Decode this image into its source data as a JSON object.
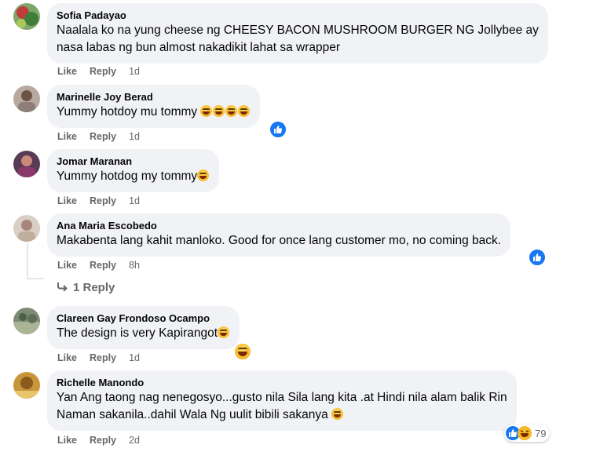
{
  "comments": [
    {
      "author": "Sofia Padayao",
      "text_lines": [
        "Naalala ko na yung cheese ng CHEESY BACON MUSHROOM BURGER NG Jollybee ay",
        "nasa labas ng bun almost nakadikit lahat sa wrapper"
      ],
      "like_label": "Like",
      "reply_label": "Reply",
      "time": "1d"
    },
    {
      "author": "Marinelle Joy Berad",
      "text": "Yummy hotdoy mu tommy",
      "like_label": "Like",
      "reply_label": "Reply",
      "time": "1d"
    },
    {
      "author": "Jomar Maranan",
      "text": "Yummy hotdog my tommy",
      "like_label": "Like",
      "reply_label": "Reply",
      "time": "1d"
    },
    {
      "author": "Ana Maria Escobedo",
      "text": "Makabenta lang kahit manloko. Good for once lang customer mo, no coming back.",
      "like_label": "Like",
      "reply_label": "Reply",
      "time": "8h",
      "replies_label": "1 Reply"
    },
    {
      "author": "Clareen Gay Frondoso Ocampo",
      "text": "The design is very Kapirangot",
      "like_label": "Like",
      "reply_label": "Reply",
      "time": "1d"
    },
    {
      "author": "Richelle Manondo",
      "text_lines": [
        "Yan Ang taong nag nenegosyo...gusto nila Sila lang kita .at Hindi nila alam balik Rin",
        "Naman sakanila..dahil Wala Ng uulit bibili sakanya"
      ],
      "like_label": "Like",
      "reply_label": "Reply",
      "time": "2d",
      "reaction_count": "79"
    }
  ],
  "icons": {
    "like_reaction": "like-reaction-icon",
    "haha_reaction": "haha-reaction-icon",
    "emoji": "laughing-emoji-icon",
    "reply_arrow": "reply-arrow-icon"
  },
  "colors": {
    "bubble": "#f0f2f5",
    "secondary_text": "#65676b",
    "like_blue": "#1877f2"
  }
}
